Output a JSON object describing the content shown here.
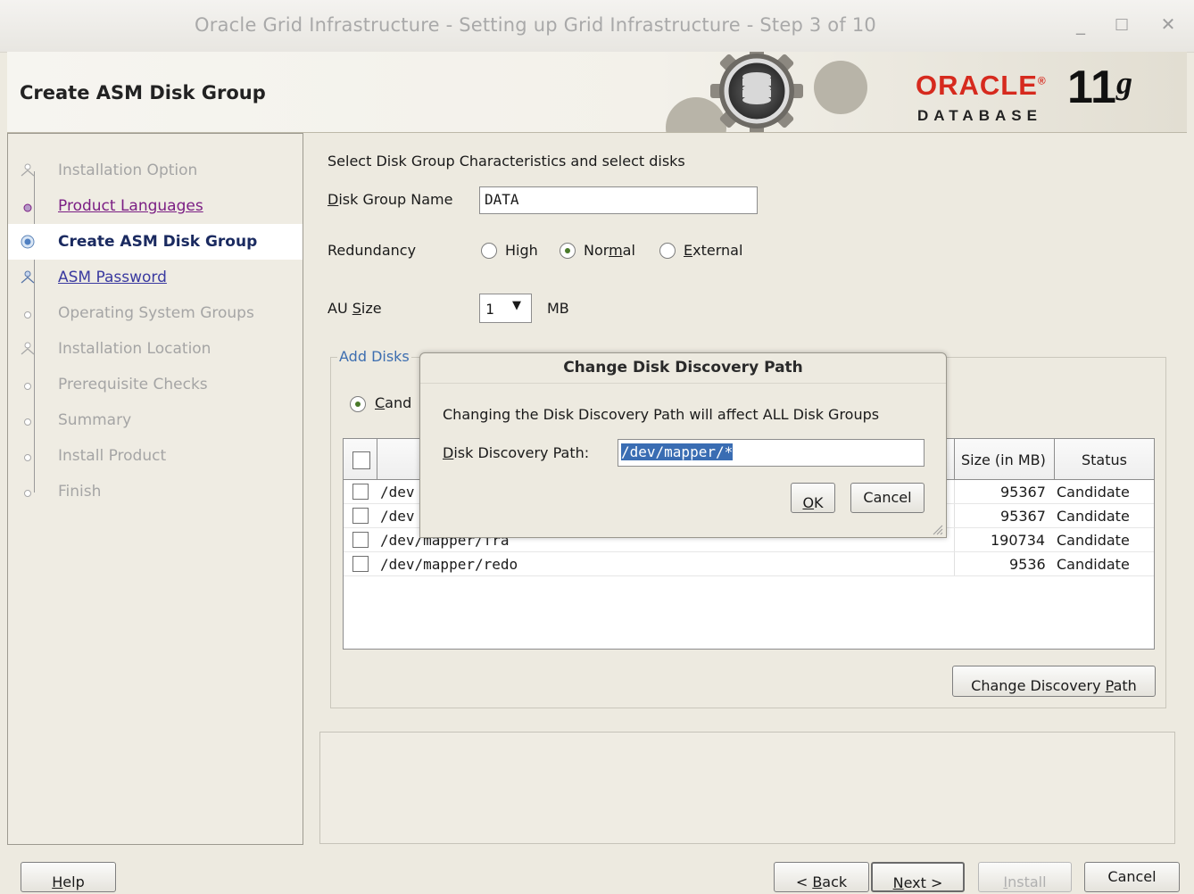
{
  "window": {
    "title": "Oracle Grid Infrastructure - Setting up Grid Infrastructure - Step 3 of 10",
    "controls": {
      "minimize": "_",
      "maximize": "□",
      "close": "✕"
    }
  },
  "header": {
    "title": "Create ASM Disk Group",
    "brand_word": "ORACLE",
    "brand_reg": "®",
    "brand_sub": "DATABASE",
    "version_num": "11",
    "version_letter": "g"
  },
  "nav": {
    "items": [
      {
        "label": "Installation Option",
        "state": "disabled"
      },
      {
        "label": "Product Languages",
        "state": "visited"
      },
      {
        "label": "Create ASM Disk Group",
        "state": "current"
      },
      {
        "label": "ASM Password",
        "state": "link"
      },
      {
        "label": "Operating System Groups",
        "state": "disabled"
      },
      {
        "label": "Installation Location",
        "state": "disabled"
      },
      {
        "label": "Prerequisite Checks",
        "state": "disabled"
      },
      {
        "label": "Summary",
        "state": "disabled"
      },
      {
        "label": "Install Product",
        "state": "disabled"
      },
      {
        "label": "Finish",
        "state": "disabled"
      }
    ]
  },
  "main": {
    "heading": "Select Disk Group Characteristics and select disks",
    "disk_group_name_label_u": "D",
    "disk_group_name_label_rest": "isk Group Name",
    "disk_group_name_value": "DATA",
    "redundancy_label": "Redundancy",
    "redundancy_options": {
      "high_a": "Hi",
      "high_u": "g",
      "high_b": "h",
      "normal_a": "Nor",
      "normal_u": "m",
      "normal_b": "al",
      "external_u": "E",
      "external_b": "xternal",
      "selected": "Normal"
    },
    "au_size_label_a": "AU ",
    "au_size_label_u": "S",
    "au_size_label_b": "ize",
    "au_size_value": "1",
    "au_size_unit": "MB",
    "add_disks_legend": "Add Disks",
    "candidate_radio_u": "C",
    "candidate_radio_b": "and",
    "table": {
      "headers": {
        "size": "Size (in MB)",
        "status": "Status"
      },
      "rows": [
        {
          "path": "/dev",
          "size": "95367",
          "status": "Candidate"
        },
        {
          "path": "/dev",
          "size": "95367",
          "status": "Candidate"
        },
        {
          "path": "/dev/mapper/fra",
          "size": "190734",
          "status": "Candidate"
        },
        {
          "path": "/dev/mapper/redo",
          "size": "9536",
          "status": "Candidate"
        }
      ]
    },
    "change_discovery_path_a": "Change Discovery ",
    "change_discovery_path_u": "P",
    "change_discovery_path_b": "ath"
  },
  "dialog": {
    "title": "Change Disk Discovery Path",
    "message": "Changing the Disk Discovery Path will affect ALL Disk Groups",
    "path_label_u": "D",
    "path_label_rest": "isk Discovery Path:",
    "path_value": "/dev/mapper/*",
    "ok_u": "O",
    "ok_b": "K",
    "cancel": "Cancel"
  },
  "footer": {
    "help_u": "H",
    "help_b": "elp",
    "back_a": "< ",
    "back_u": "B",
    "back_b": "ack",
    "next_u": "N",
    "next_b": "ext >",
    "install_u": "I",
    "install_b": "nstall",
    "cancel": "Cancel"
  }
}
